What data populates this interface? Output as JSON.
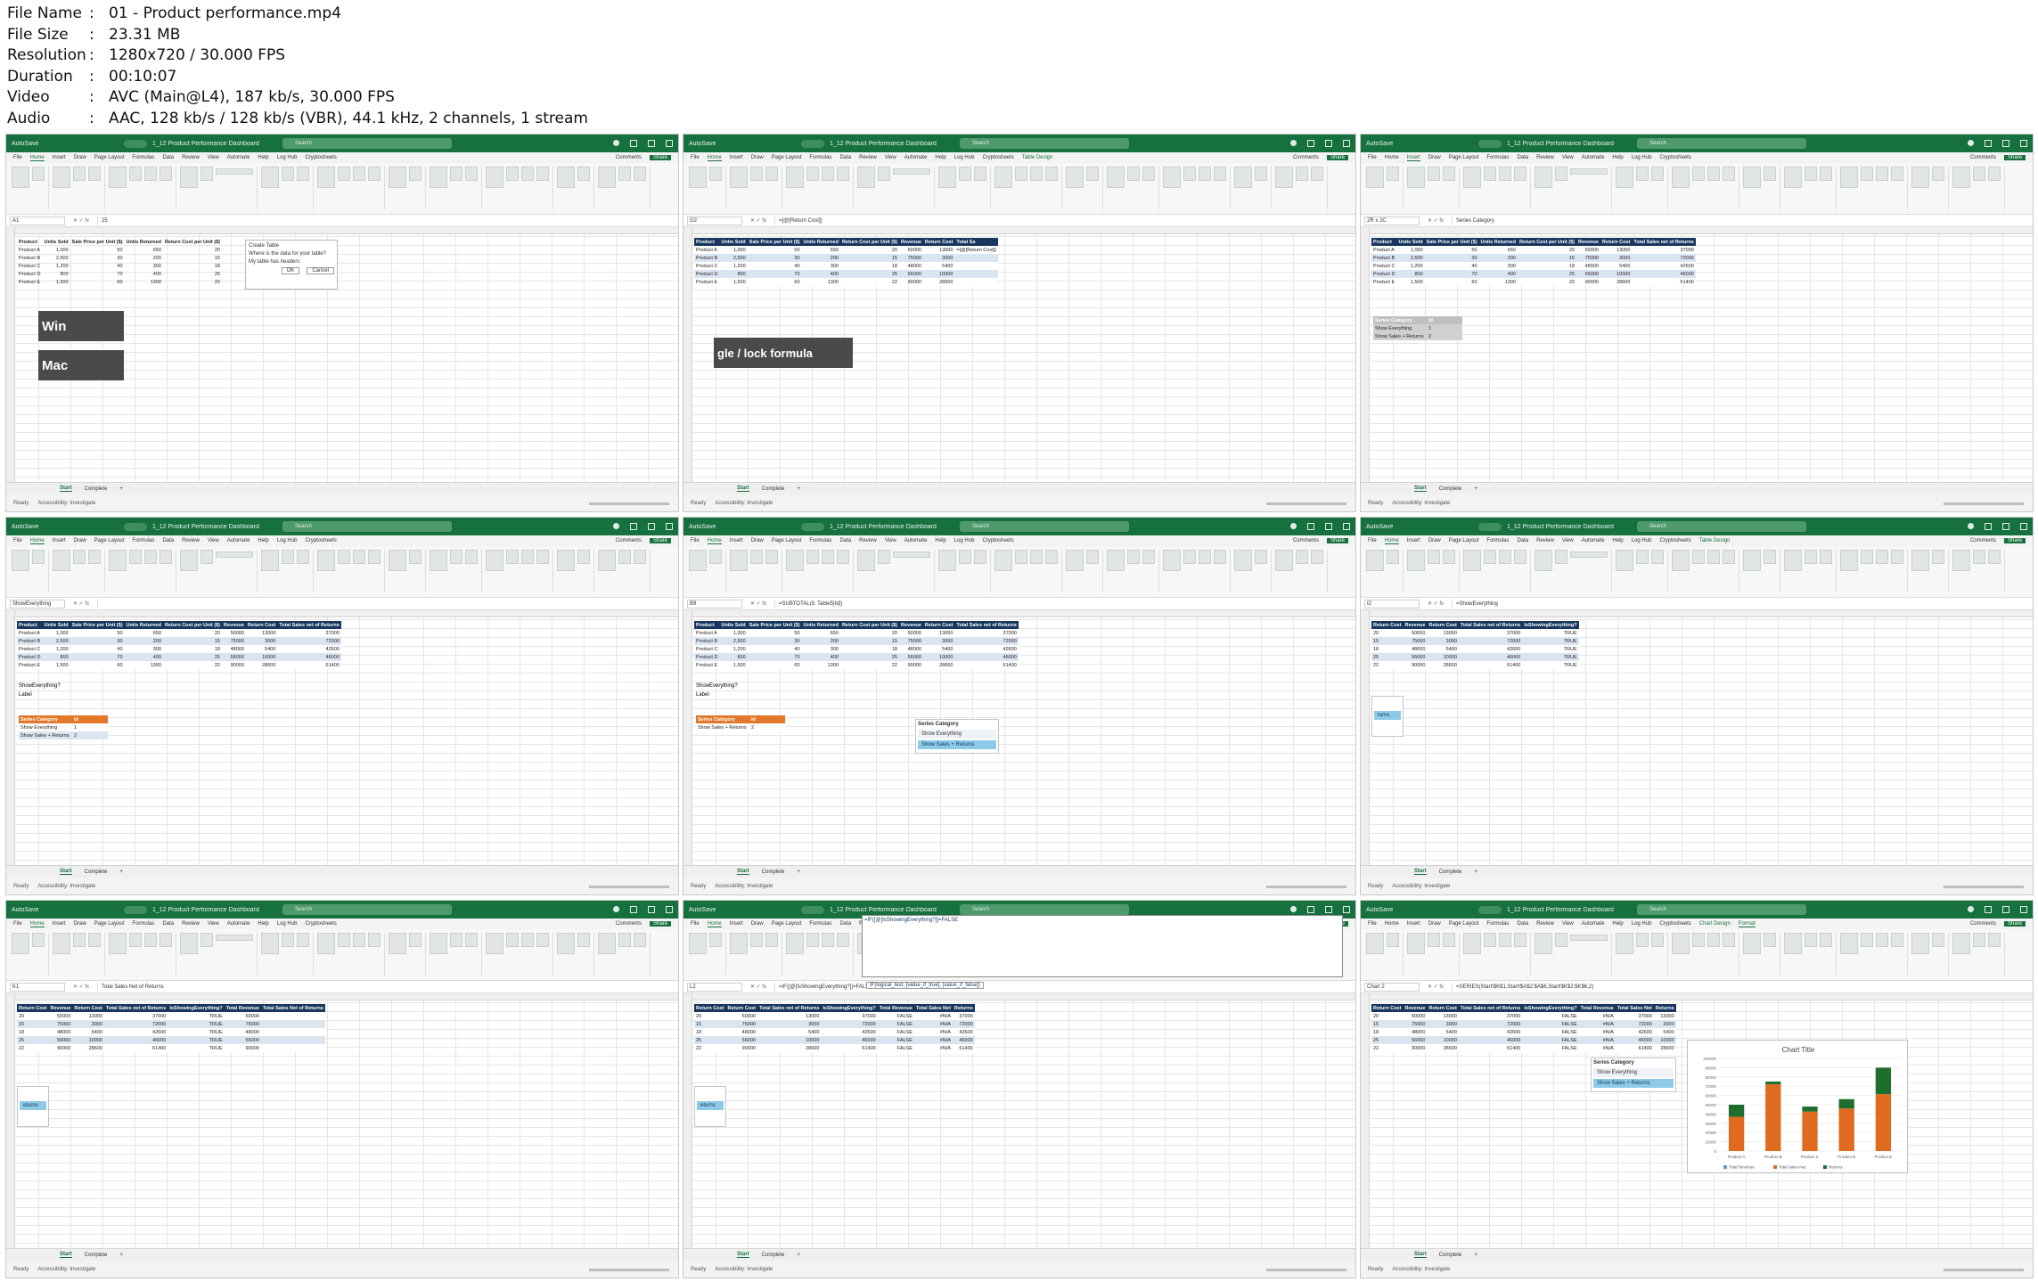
{
  "file_info": [
    {
      "key": "File Name",
      "value": "01 - Product performance.mp4"
    },
    {
      "key": "File Size",
      "value": "23.31 MB"
    },
    {
      "key": "Resolution",
      "value": "1280x720 / 30.000 FPS"
    },
    {
      "key": "Duration",
      "value": "00:10:07"
    },
    {
      "key": "Video",
      "value": "AVC (Main@L4), 187 kb/s, 30.000 FPS"
    },
    {
      "key": "Audio",
      "value": "AAC, 128 kb/s / 128 kb/s (VBR), 44.1 kHz, 2 channels, 1 stream"
    }
  ],
  "app": {
    "window_title": "1_12 Product Performance Dashboard",
    "search_placeholder": "Search",
    "autosave": "AutoSave",
    "menus": [
      "File",
      "Home",
      "Insert",
      "Draw",
      "Page Layout",
      "Formulas",
      "Data",
      "Review",
      "View",
      "Automate",
      "Help",
      "Log Hub",
      "Cryptosheets"
    ],
    "comments": "Comments",
    "share": "Share",
    "sheet_tabs": [
      "Start",
      "Complete"
    ],
    "status": "Ready",
    "accessibility": "Accessibility: Investigate"
  },
  "tiles": [
    {
      "active_menu": "Home",
      "context_tab": "",
      "name_box": "A1",
      "formula": "25",
      "headers": [
        "Product",
        "Units Sold",
        "Sale Price per Unit ($)",
        "Units Returned",
        "Return Cost per Unit ($)"
      ],
      "rows": [
        [
          "Product A",
          "1,000",
          "50",
          "650",
          "20"
        ],
        [
          "Product B",
          "2,500",
          "30",
          "200",
          "15"
        ],
        [
          "Product C",
          "1,200",
          "40",
          "300",
          "18"
        ],
        [
          "Product D",
          "800",
          "70",
          "400",
          "25"
        ],
        [
          "Product E",
          "1,500",
          "60",
          "1300",
          "22"
        ]
      ],
      "dialog": {
        "title": "Create Table",
        "question": "Where is the data for your table?",
        "checkbox": "My table has headers",
        "ok": "OK",
        "cancel": "Cancel"
      },
      "overlays": [
        "Win",
        "Mac"
      ]
    },
    {
      "active_menu": "Home",
      "context_tab": "Table Design",
      "name_box": "G2",
      "formula": "=[@[Return Cost]]",
      "headers": [
        "Product",
        "Units Sold",
        "Sale Price per Unit ($)",
        "Units Returned",
        "Return Cost per Unit ($)",
        "Revenue",
        "Return Cost",
        "Total Sa"
      ],
      "rows": [
        [
          "Product A",
          "1,000",
          "50",
          "650",
          "20",
          "50000",
          "13000",
          "=[@[Return Cost]]"
        ],
        [
          "Product B",
          "2,500",
          "30",
          "200",
          "15",
          "75000",
          "3000",
          ""
        ],
        [
          "Product C",
          "1,200",
          "40",
          "300",
          "18",
          "48000",
          "5400",
          ""
        ],
        [
          "Product D",
          "800",
          "70",
          "400",
          "25",
          "56000",
          "10000",
          ""
        ],
        [
          "Product E",
          "1,500",
          "60",
          "1300",
          "22",
          "90000",
          "28600",
          ""
        ]
      ],
      "overlays": [
        "gle / lock formula"
      ]
    },
    {
      "active_menu": "Insert",
      "context_tab": "",
      "name_box": "2R x 2C",
      "formula": "Series Category",
      "headers": [
        "Product",
        "Units Sold",
        "Sale Price per Unit ($)",
        "Units Returned",
        "Return Cost per Unit ($)",
        "Revenue",
        "Return Cost",
        "Total Sales net of Returns"
      ],
      "rows": [
        [
          "Product A",
          "1,000",
          "50",
          "650",
          "20",
          "50000",
          "13000",
          "37000"
        ],
        [
          "Product B",
          "2,500",
          "30",
          "200",
          "15",
          "75000",
          "3000",
          "72000"
        ],
        [
          "Product C",
          "1,200",
          "40",
          "300",
          "18",
          "48000",
          "5400",
          "42600"
        ],
        [
          "Product D",
          "800",
          "70",
          "400",
          "25",
          "56000",
          "10000",
          "46000"
        ],
        [
          "Product E",
          "1,500",
          "60",
          "1300",
          "22",
          "90000",
          "28600",
          "61400"
        ]
      ],
      "mini_table": [
        [
          "Series Category",
          "Id"
        ],
        [
          "Show Everything",
          "1"
        ],
        [
          "Show Sales + Returns",
          "2"
        ]
      ]
    },
    {
      "active_menu": "Home",
      "context_tab": "",
      "name_box": "ShowEverything",
      "formula": "",
      "headers": [
        "Product",
        "Units Sold",
        "Sale Price per Unit ($)",
        "Units Returned",
        "Return Cost per Unit ($)",
        "Revenue",
        "Return Cost",
        "Total Sales net of Returns"
      ],
      "rows": [
        [
          "Product A",
          "1,000",
          "50",
          "650",
          "20",
          "50000",
          "13000",
          "37000"
        ],
        [
          "Product B",
          "2,500",
          "30",
          "200",
          "15",
          "75000",
          "3000",
          "72000"
        ],
        [
          "Product C",
          "1,200",
          "40",
          "300",
          "18",
          "48000",
          "5400",
          "42600"
        ],
        [
          "Product D",
          "800",
          "70",
          "400",
          "25",
          "56000",
          "10000",
          "46000"
        ],
        [
          "Product E",
          "1,500",
          "60",
          "1300",
          "22",
          "90000",
          "28600",
          "61400"
        ]
      ],
      "extra_labels": [
        "ShowEverything?",
        "Label"
      ],
      "mini_table": [
        [
          "Series Category",
          "Id"
        ],
        [
          "Show Everything",
          "1"
        ],
        [
          "Show Sales + Returns",
          "2"
        ]
      ]
    },
    {
      "active_menu": "Home",
      "context_tab": "",
      "name_box": "B9",
      "formula": "=SUBTOTAL(9, Table5[Id])",
      "headers": [
        "Product",
        "Units Sold",
        "Sale Price per Unit ($)",
        "Units Returned",
        "Return Cost per Unit ($)",
        "Revenue",
        "Return Cost",
        "Total Sales net of Returns"
      ],
      "rows": [
        [
          "Product A",
          "1,000",
          "50",
          "650",
          "20",
          "50000",
          "13000",
          "37000"
        ],
        [
          "Product B",
          "2,500",
          "30",
          "200",
          "15",
          "75000",
          "3000",
          "72000"
        ],
        [
          "Product C",
          "1,200",
          "40",
          "300",
          "18",
          "48000",
          "5400",
          "42600"
        ],
        [
          "Product D",
          "800",
          "70",
          "400",
          "25",
          "56000",
          "10000",
          "46000"
        ],
        [
          "Product E",
          "1,500",
          "60",
          "1300",
          "22",
          "90000",
          "28600",
          "61400"
        ]
      ],
      "extra_labels": [
        "ShowEverything?",
        "Label"
      ],
      "mini_table": [
        [
          "Series Category",
          "Id"
        ],
        [
          "Show Sales + Returns",
          "2"
        ]
      ],
      "slicer": {
        "title": "Series Category",
        "items": [
          "Show Everything",
          "Show Sales + Returns"
        ],
        "selected": 1
      }
    },
    {
      "active_menu": "Home",
      "context_tab": "Table Design",
      "name_box": "I2",
      "formula": "=ShowEverything",
      "headers": [
        "Return Cost",
        "Revenue",
        "Return Cost",
        "Total Sales net of Returns",
        "IsShowingEverything?"
      ],
      "rows": [
        [
          "20",
          "50000",
          "13000",
          "37000",
          "TRUE"
        ],
        [
          "15",
          "75000",
          "3000",
          "72000",
          "TRUE"
        ],
        [
          "18",
          "48000",
          "5400",
          "42600",
          "TRUE"
        ],
        [
          "25",
          "56000",
          "10000",
          "46000",
          "TRUE"
        ],
        [
          "22",
          "90000",
          "28600",
          "61400",
          "TRUE"
        ]
      ],
      "side_text": "turns"
    },
    {
      "active_menu": "Home",
      "context_tab": "",
      "name_box": "K1",
      "formula": "Total Sales Net of Returns",
      "headers": [
        "Return Cost",
        "Revenue",
        "Return Cost",
        "Total Sales net of Returns",
        "IsShowingEverything?",
        "Total Revenue",
        "Total Sales Net of Returns"
      ],
      "rows": [
        [
          "20",
          "50000",
          "13000",
          "37000",
          "TRUE",
          "50000",
          ""
        ],
        [
          "15",
          "75000",
          "3000",
          "72000",
          "TRUE",
          "75000",
          ""
        ],
        [
          "18",
          "48000",
          "5400",
          "42600",
          "TRUE",
          "48000",
          ""
        ],
        [
          "25",
          "56000",
          "10000",
          "46000",
          "TRUE",
          "56000",
          ""
        ],
        [
          "22",
          "90000",
          "28600",
          "61400",
          "TRUE",
          "90000",
          ""
        ]
      ],
      "side_text": "eturns"
    },
    {
      "active_menu": "Home",
      "context_tab": "Table Design",
      "name_box": "L2",
      "formula": "=IF([@[IsShowingEverything?]]=FALSE",
      "headers": [
        "Return Cost",
        "Return Cost",
        "Total Sales net of Returns",
        "IsShowingEverything?",
        "Total Revenue",
        "Total Sales Net",
        "Returns"
      ],
      "rows": [
        [
          "20",
          "50000",
          "13000",
          "37000",
          "FALSE",
          "#N/A",
          "37000"
        ],
        [
          "15",
          "75000",
          "3000",
          "72000",
          "FALSE",
          "#N/A",
          "72000"
        ],
        [
          "18",
          "48000",
          "5400",
          "42600",
          "FALSE",
          "#N/A",
          "42600"
        ],
        [
          "25",
          "56000",
          "10000",
          "46000",
          "FALSE",
          "#N/A",
          "46000"
        ],
        [
          "22",
          "90000",
          "28600",
          "61400",
          "FALSE",
          "#N/A",
          "61400"
        ]
      ],
      "tooltip": "IF(logical_test, [value_if_true], [value_if_false])",
      "side_text": "eturns"
    },
    {
      "active_menu": "Format",
      "context_tab": "Chart Design",
      "name_box": "Chart 2",
      "formula": "=SERIES(Start!$K$1,Start!$A$2:$A$6,Start!$K$2:$K$6,2)",
      "headers": [
        "Return Cost",
        "Revenue",
        "Return Cost",
        "Total Sales net of Returns",
        "IsShowingEverything?",
        "Total Revenue",
        "Total Sales Net",
        "Returns"
      ],
      "rows": [
        [
          "20",
          "50000",
          "13000",
          "37000",
          "FALSE",
          "#N/A",
          "37000",
          "13000"
        ],
        [
          "15",
          "75000",
          "3000",
          "72000",
          "FALSE",
          "#N/A",
          "72000",
          "3000"
        ],
        [
          "18",
          "48000",
          "5400",
          "42600",
          "FALSE",
          "#N/A",
          "42600",
          "5400"
        ],
        [
          "25",
          "56000",
          "10000",
          "46000",
          "FALSE",
          "#N/A",
          "46000",
          "10000"
        ],
        [
          "22",
          "90000",
          "28600",
          "61400",
          "FALSE",
          "#N/A",
          "61400",
          "28600"
        ]
      ],
      "slicer": {
        "title": "Series Category",
        "items": [
          "Show Everything",
          "Show Sales + Returns"
        ],
        "selected": 1
      }
    }
  ],
  "chart_data": {
    "type": "bar",
    "title": "Chart Title",
    "categories": [
      "Product A",
      "Product B",
      "Product C",
      "Product D",
      "Product E"
    ],
    "series": [
      {
        "name": "Total Sales Net",
        "values": [
          37000,
          72000,
          42600,
          46000,
          61400
        ],
        "color": "#e06b1f"
      },
      {
        "name": "Returns",
        "values": [
          13000,
          3000,
          5400,
          10000,
          28600
        ],
        "color": "#1f6e2e"
      }
    ],
    "ylim": [
      0,
      100000
    ],
    "y_ticks": [
      "0",
      "10000",
      "20000",
      "30000",
      "40000",
      "50000",
      "60000",
      "70000",
      "80000",
      "90000",
      "100000"
    ],
    "legend": [
      "Total Revenue",
      "Total Sales Net",
      "Returns"
    ],
    "legend_placement": "bottom",
    "stacked": true
  },
  "colors": {
    "excel_green": "#17713f",
    "table_header": "#17375e",
    "band": "#dbe5f1",
    "slicer_selected": "#8ec9e8"
  }
}
